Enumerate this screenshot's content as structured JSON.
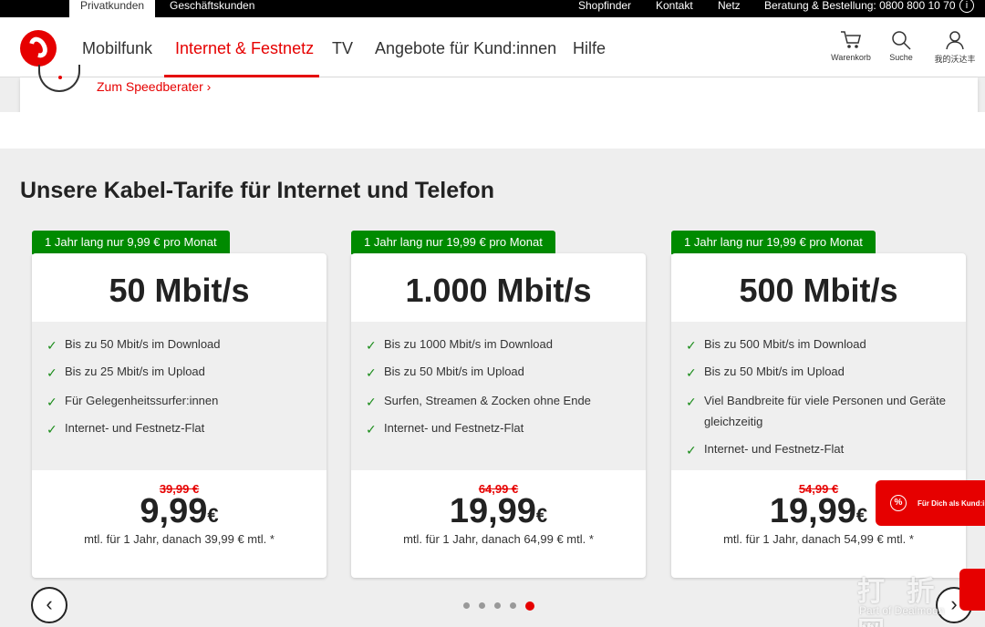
{
  "topbar": {
    "tab_private": "Privatkunden",
    "tab_business": "Geschäftskunden",
    "shopfinder": "Shopfinder",
    "contact": "Kontakt",
    "network": "Netz",
    "hotline": "Beratung & Bestellung: 0800 800 10 70",
    "info_icon": "i"
  },
  "header": {
    "nav": [
      "Mobilfunk",
      "Internet & Festnetz",
      "TV",
      "Angebote für Kund:innen",
      "Hilfe"
    ],
    "cart_label": "Warenkorb",
    "search_label": "Suche",
    "account_label": "我的沃达丰"
  },
  "speed_card": {
    "link": "Zum Speedberater"
  },
  "section": {
    "title": "Unsere Kabel-Tarife für Internet und Telefon"
  },
  "tariffs": [
    {
      "badge": "1 Jahr lang nur 9,99 € pro Monat",
      "speed": "50 Mbit/s",
      "features": [
        "Bis zu 50 Mbit/s im Download",
        "Bis zu 25 Mbit/s im Upload",
        "Für Gelegenheitssurfer:innen",
        "Internet- und Festnetz-Flat"
      ],
      "old_price": "39,99 €",
      "price": "9,99",
      "currency": "€",
      "note": "mtl. für 1 Jahr, danach 39,99 € mtl. *"
    },
    {
      "badge": "1 Jahr lang nur 19,99 € pro Monat",
      "speed": "1.000 Mbit/s",
      "features": [
        "Bis zu 1000 Mbit/s im Download",
        "Bis zu 50 Mbit/s im Upload",
        "Surfen, Streamen & Zocken ohne Ende",
        "Internet- und Festnetz-Flat"
      ],
      "old_price": "64,99 €",
      "price": "19,99",
      "currency": "€",
      "note": "mtl. für 1 Jahr, danach 64,99 € mtl. *"
    },
    {
      "badge": "1 Jahr lang nur 19,99 € pro Monat",
      "speed": "500 Mbit/s",
      "features": [
        "Bis zu 500 Mbit/s im Download",
        "Bis zu 50 Mbit/s im Upload",
        "Viel Bandbreite für viele Personen und Geräte gleichzeitig",
        "Internet- und Festnetz-Flat"
      ],
      "old_price": "54,99 €",
      "price": "19,99",
      "currency": "€",
      "note": "mtl. für 1 Jahr, danach 54,99 € mtl. *"
    }
  ],
  "carousel": {
    "prev": "‹",
    "next": "›",
    "dots": 5,
    "active_dot": 5
  },
  "promo": {
    "label": "Für Dich als Kund:in",
    "icon": "%"
  },
  "watermark": {
    "title": "打 折 网",
    "sub": "Part of Dealmoon"
  },
  "colors": {
    "brand_red": "#e60000",
    "badge_green": "#008a00",
    "check_green": "#1a8c1a"
  }
}
